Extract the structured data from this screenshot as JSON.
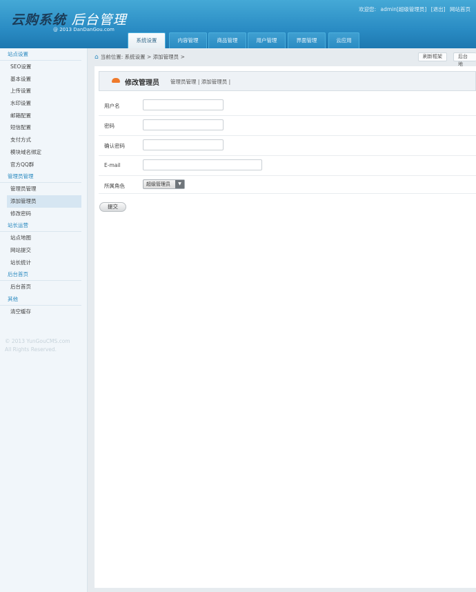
{
  "header": {
    "logo_main": "云购系统",
    "logo_sub": "后台管理",
    "copyright": "@ 2013  DanDanGou.com",
    "welcome": "欢迎您:",
    "user": "admin",
    "role": "[超级管理员]",
    "logout": "[退出]",
    "site_home": "网站首页"
  },
  "tabs": [
    "系统设置",
    "内容管理",
    "商品管理",
    "用户管理",
    "界面管理",
    "云应用"
  ],
  "sidebar": {
    "groups": [
      {
        "title": "站点设置",
        "items": [
          "SEO设置",
          "基本设置",
          "上传设置",
          "水印设置",
          "邮箱配置",
          "短信配置",
          "支付方式",
          "模块域名绑定",
          "官方QQ群"
        ]
      },
      {
        "title": "管理员管理",
        "items": [
          "管理员管理",
          "添加管理员",
          "修改密码"
        ]
      },
      {
        "title": "站长运营",
        "items": [
          "站点地图",
          "网站提交",
          "站长统计"
        ]
      },
      {
        "title": "后台首页",
        "items": [
          "后台首页"
        ]
      },
      {
        "title": "其他",
        "items": [
          "清空缓存"
        ]
      }
    ],
    "footer1": "© 2013 YunGouCMS.com",
    "footer2": "All Rights Reserved."
  },
  "breadcrumb": "当前位置: 系统设置 > 添加管理员 >",
  "toolbar": {
    "refresh": "刷新框架",
    "backend": "后台地"
  },
  "panel": {
    "title": "修改管理员",
    "links": "管理员管理 | 添加管理员 |"
  },
  "form": {
    "username_label": "用户名",
    "password_label": "密码",
    "confirm_label": "确认密码",
    "email_label": "E-mail",
    "role_label": "所属角色",
    "role_value": "超级管理员",
    "submit": "提交"
  }
}
